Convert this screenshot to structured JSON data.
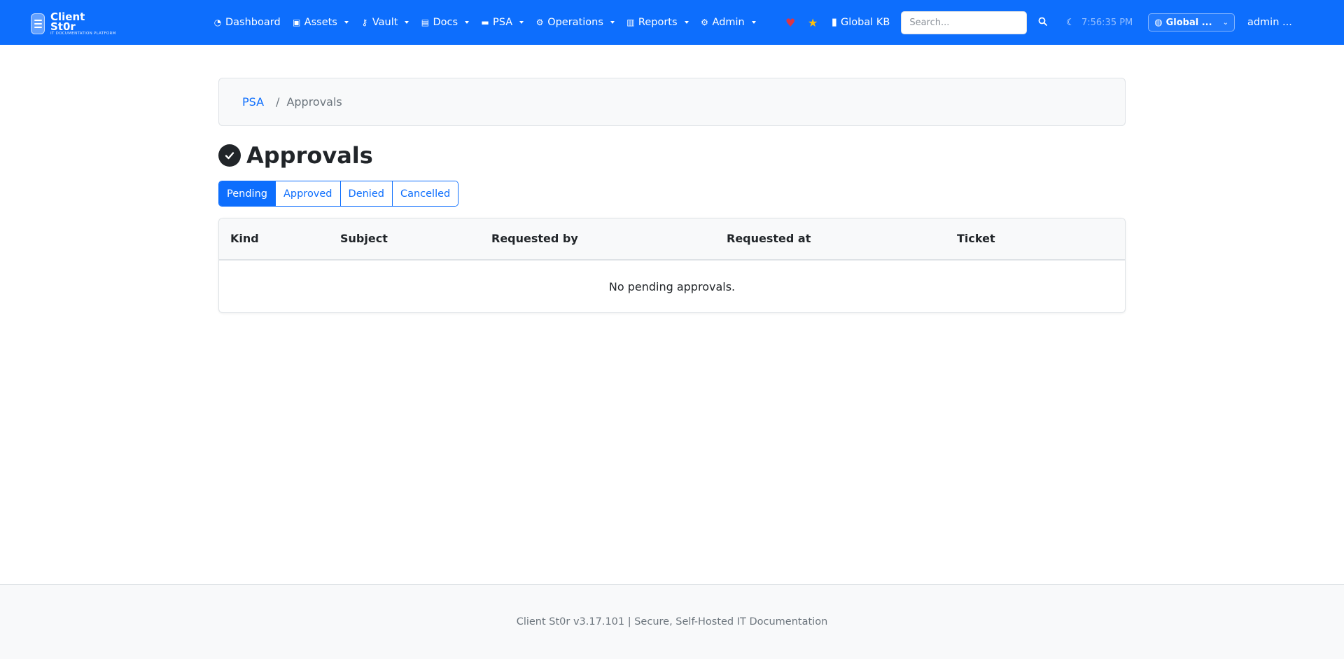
{
  "brand": {
    "name": "Client St0r",
    "tagline": "IT DOCUMENTATION PLATFORM"
  },
  "nav": {
    "items": [
      {
        "label": "Dashboard",
        "icon": "gauge-icon",
        "dropdown": false
      },
      {
        "label": "Assets",
        "icon": "box-icon",
        "dropdown": true
      },
      {
        "label": "Vault",
        "icon": "key-icon",
        "dropdown": true
      },
      {
        "label": "Docs",
        "icon": "file-icon",
        "dropdown": true
      },
      {
        "label": "PSA",
        "icon": "ticket-icon",
        "dropdown": true
      },
      {
        "label": "Operations",
        "icon": "gears-icon",
        "dropdown": true
      },
      {
        "label": "Reports",
        "icon": "chart-icon",
        "dropdown": true
      },
      {
        "label": "Admin",
        "icon": "gear-icon",
        "dropdown": true
      }
    ],
    "kb_label": "Global KB",
    "search_placeholder": "Search...",
    "clock": "7:56:35 PM",
    "tenant_label": "Global ...",
    "user_label": "admin ..."
  },
  "breadcrumb": {
    "parent": "PSA",
    "separator": "/",
    "current": "Approvals"
  },
  "page": {
    "title": "Approvals"
  },
  "tabs": [
    {
      "label": "Pending",
      "active": true
    },
    {
      "label": "Approved",
      "active": false
    },
    {
      "label": "Denied",
      "active": false
    },
    {
      "label": "Cancelled",
      "active": false
    }
  ],
  "table": {
    "columns": [
      "Kind",
      "Subject",
      "Requested by",
      "Requested at",
      "Ticket"
    ],
    "empty_message": "No pending approvals."
  },
  "footer": {
    "text": "Client St0r v3.17.101 | Secure, Self-Hosted IT Documentation"
  },
  "colors": {
    "primary": "#0d6efd",
    "heart": "#dc3545",
    "star": "#ffc107"
  }
}
